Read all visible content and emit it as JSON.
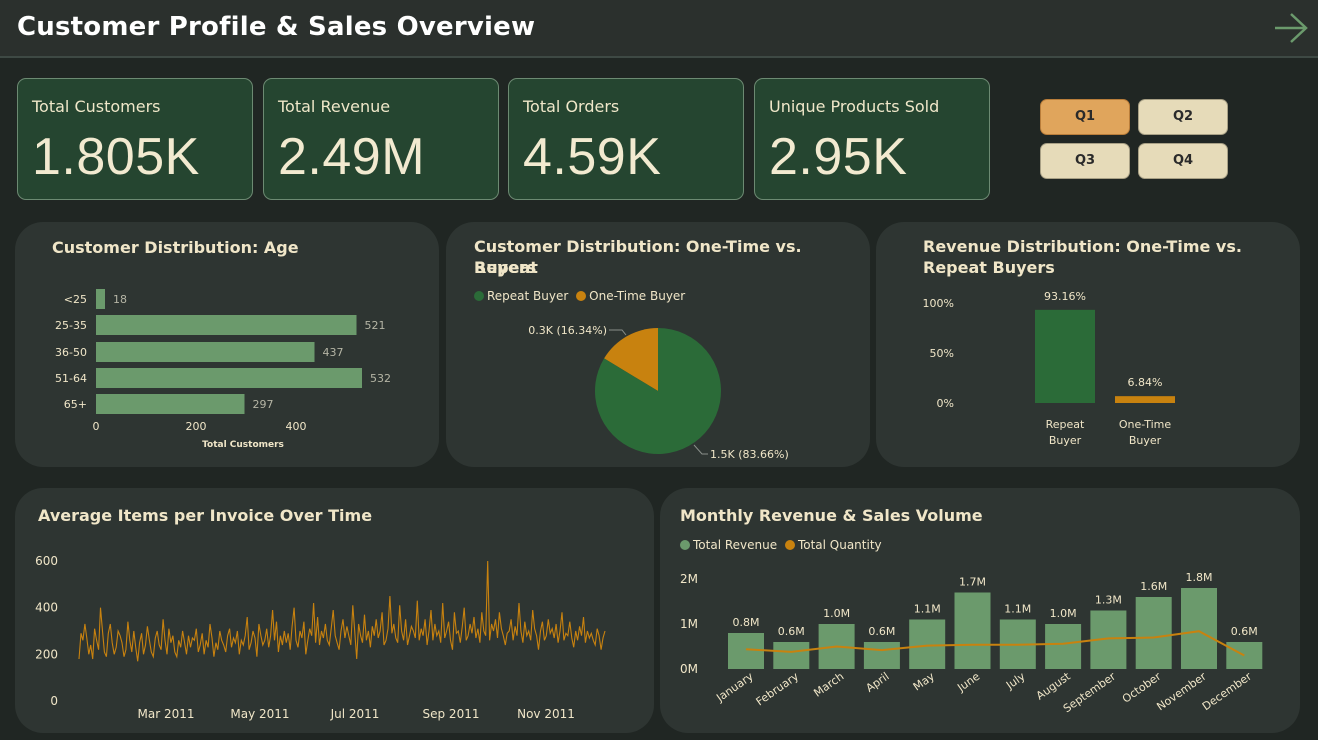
{
  "header": {
    "title": "Customer Profile & Sales Overview",
    "nav_icon": "arrow-right-icon"
  },
  "kpis": [
    {
      "label": "Total Customers",
      "value": "1.805K"
    },
    {
      "label": "Total Revenue",
      "value": "2.49M"
    },
    {
      "label": "Total Orders",
      "value": "4.59K"
    },
    {
      "label": "Unique Products Sold",
      "value": "2.95K"
    }
  ],
  "quarters": {
    "q1": "Q1",
    "q2": "Q2",
    "q3": "Q3",
    "q4": "Q4",
    "selected": "Q1"
  },
  "colors": {
    "accent_green": "#6b9a6c",
    "dark_green": "#2b6b38",
    "orange": "#c8820f",
    "cream": "#f0e6c8"
  },
  "age_card": {
    "title": "Customer Distribution: Age"
  },
  "buyers_card": {
    "title_line1": "Customer Distribution: One-Time vs. Repeat",
    "title_line2": "Buyers",
    "legend_repeat": "Repeat Buyer",
    "legend_one": "One-Time Buyer"
  },
  "revdist_card": {
    "title_line1": "Revenue Distribution: One-Time vs.",
    "title_line2": "Repeat Buyers"
  },
  "items_card": {
    "title": "Average Items per Invoice Over Time"
  },
  "monthly_card": {
    "title": "Monthly Revenue & Sales Volume",
    "legend_revenue": "Total Revenue",
    "legend_quantity": "Total Quantity"
  },
  "chart_data": [
    {
      "type": "bar",
      "orientation": "horizontal",
      "title": "Customer Distribution: Age",
      "categories": [
        "<25",
        "25-35",
        "36-50",
        "51-64",
        "65+"
      ],
      "values": [
        18,
        521,
        437,
        532,
        297
      ],
      "xlabel": "Total Customers",
      "xticks": [
        0,
        200,
        400
      ],
      "xlim": [
        0,
        600
      ]
    },
    {
      "type": "pie",
      "title": "Customer Distribution: One-Time vs. Repeat Buyers",
      "series": [
        {
          "name": "Repeat Buyer",
          "value": 83.66,
          "label": "1.5K (83.66%)",
          "color": "#2b6b38"
        },
        {
          "name": "One-Time Buyer",
          "value": 16.34,
          "label": "0.3K (16.34%)",
          "color": "#c8820f"
        }
      ]
    },
    {
      "type": "bar",
      "title": "Revenue Distribution: One-Time vs. Repeat Buyers",
      "categories": [
        "Repeat Buyer",
        "One-Time Buyer"
      ],
      "values": [
        93.16,
        6.84
      ],
      "labels": [
        "93.16%",
        "6.84%"
      ],
      "yticks": [
        "100%",
        "50%",
        "0%"
      ],
      "ylim": [
        0,
        100
      ]
    },
    {
      "type": "line",
      "title": "Average Items per Invoice Over Time",
      "x_range": [
        "2010-12-01",
        "2011-12-09"
      ],
      "xticks": [
        "Mar 2011",
        "May 2011",
        "Jul 2011",
        "Sep 2011",
        "Nov 2011"
      ],
      "yticks": [
        0,
        200,
        400,
        600
      ],
      "ylim": [
        0,
        650
      ],
      "values": [
        180,
        290,
        260,
        330,
        270,
        200,
        240,
        180,
        310,
        260,
        220,
        400,
        300,
        210,
        190,
        290,
        330,
        250,
        200,
        230,
        300,
        280,
        250,
        190,
        220,
        340,
        260,
        210,
        300,
        230,
        170,
        250,
        290,
        200,
        240,
        320,
        260,
        210,
        190,
        270,
        300,
        240,
        220,
        350,
        260,
        200,
        310,
        250,
        280,
        210,
        190,
        260,
        230,
        300,
        250,
        200,
        280,
        230,
        270,
        260,
        310,
        210,
        240,
        290,
        200,
        260,
        230,
        330,
        270,
        190,
        250,
        220,
        300,
        260,
        240,
        210,
        280,
        310,
        230,
        270,
        250,
        300,
        200,
        260,
        240,
        280,
        360,
        220,
        250,
        300,
        270,
        190,
        330,
        280,
        240,
        260,
        310,
        230,
        280,
        390,
        260,
        340,
        210,
        280,
        240,
        300,
        250,
        290,
        220,
        320,
        400,
        260,
        230,
        300,
        270,
        340,
        200,
        260,
        310,
        280,
        420,
        250,
        360,
        240,
        300,
        270,
        330,
        260,
        240,
        310,
        390,
        280,
        250,
        220,
        300,
        350,
        270,
        320,
        280,
        240,
        410,
        300,
        180,
        330,
        280,
        250,
        370,
        260,
        300,
        230,
        320,
        280,
        350,
        270,
        300,
        380,
        240,
        260,
        310,
        450,
        290,
        330,
        270,
        250,
        410,
        300,
        260,
        350,
        240,
        280,
        320,
        300,
        270,
        430,
        260,
        310,
        280,
        350,
        240,
        300,
        390,
        260,
        330,
        280,
        300,
        250,
        420,
        270,
        300,
        340,
        260,
        220,
        380,
        290,
        300,
        250,
        320,
        400,
        260,
        280,
        330,
        290,
        360,
        270,
        310,
        250,
        380,
        300,
        280,
        600,
        260,
        330,
        300,
        350,
        270,
        380,
        310,
        280,
        240,
        290,
        300,
        350,
        260,
        320,
        280,
        420,
        300,
        250,
        340,
        280,
        300,
        260,
        390,
        310,
        280,
        220,
        300,
        340,
        260,
        280,
        350,
        290,
        310,
        270,
        330,
        250,
        300,
        380,
        260,
        290,
        280,
        340,
        270,
        230,
        300,
        260,
        320,
        280,
        360,
        250,
        300,
        270,
        290,
        260,
        240,
        310,
        280,
        220,
        270,
        300
      ]
    },
    {
      "type": "bar",
      "title": "Monthly Revenue & Sales Volume",
      "categories": [
        "January",
        "February",
        "March",
        "April",
        "May",
        "June",
        "July",
        "August",
        "September",
        "October",
        "November",
        "December"
      ],
      "series": [
        {
          "name": "Total Revenue",
          "values": [
            0.8,
            0.6,
            1.0,
            0.6,
            1.1,
            1.7,
            1.1,
            1.0,
            1.3,
            1.6,
            1.8,
            0.6
          ],
          "labels": [
            "0.8M",
            "0.6M",
            "1.0M",
            "0.6M",
            "1.1M",
            "1.7M",
            "1.1M",
            "1.0M",
            "1.3M",
            "1.6M",
            "1.8M",
            "0.6M"
          ]
        },
        {
          "name": "Total Quantity",
          "type": "line",
          "values": [
            0.44,
            0.38,
            0.5,
            0.42,
            0.52,
            0.54,
            0.54,
            0.56,
            0.68,
            0.7,
            0.84,
            0.3
          ]
        }
      ],
      "yticks": [
        "2M",
        "1M",
        "0M"
      ],
      "ylim": [
        0,
        2
      ]
    }
  ]
}
